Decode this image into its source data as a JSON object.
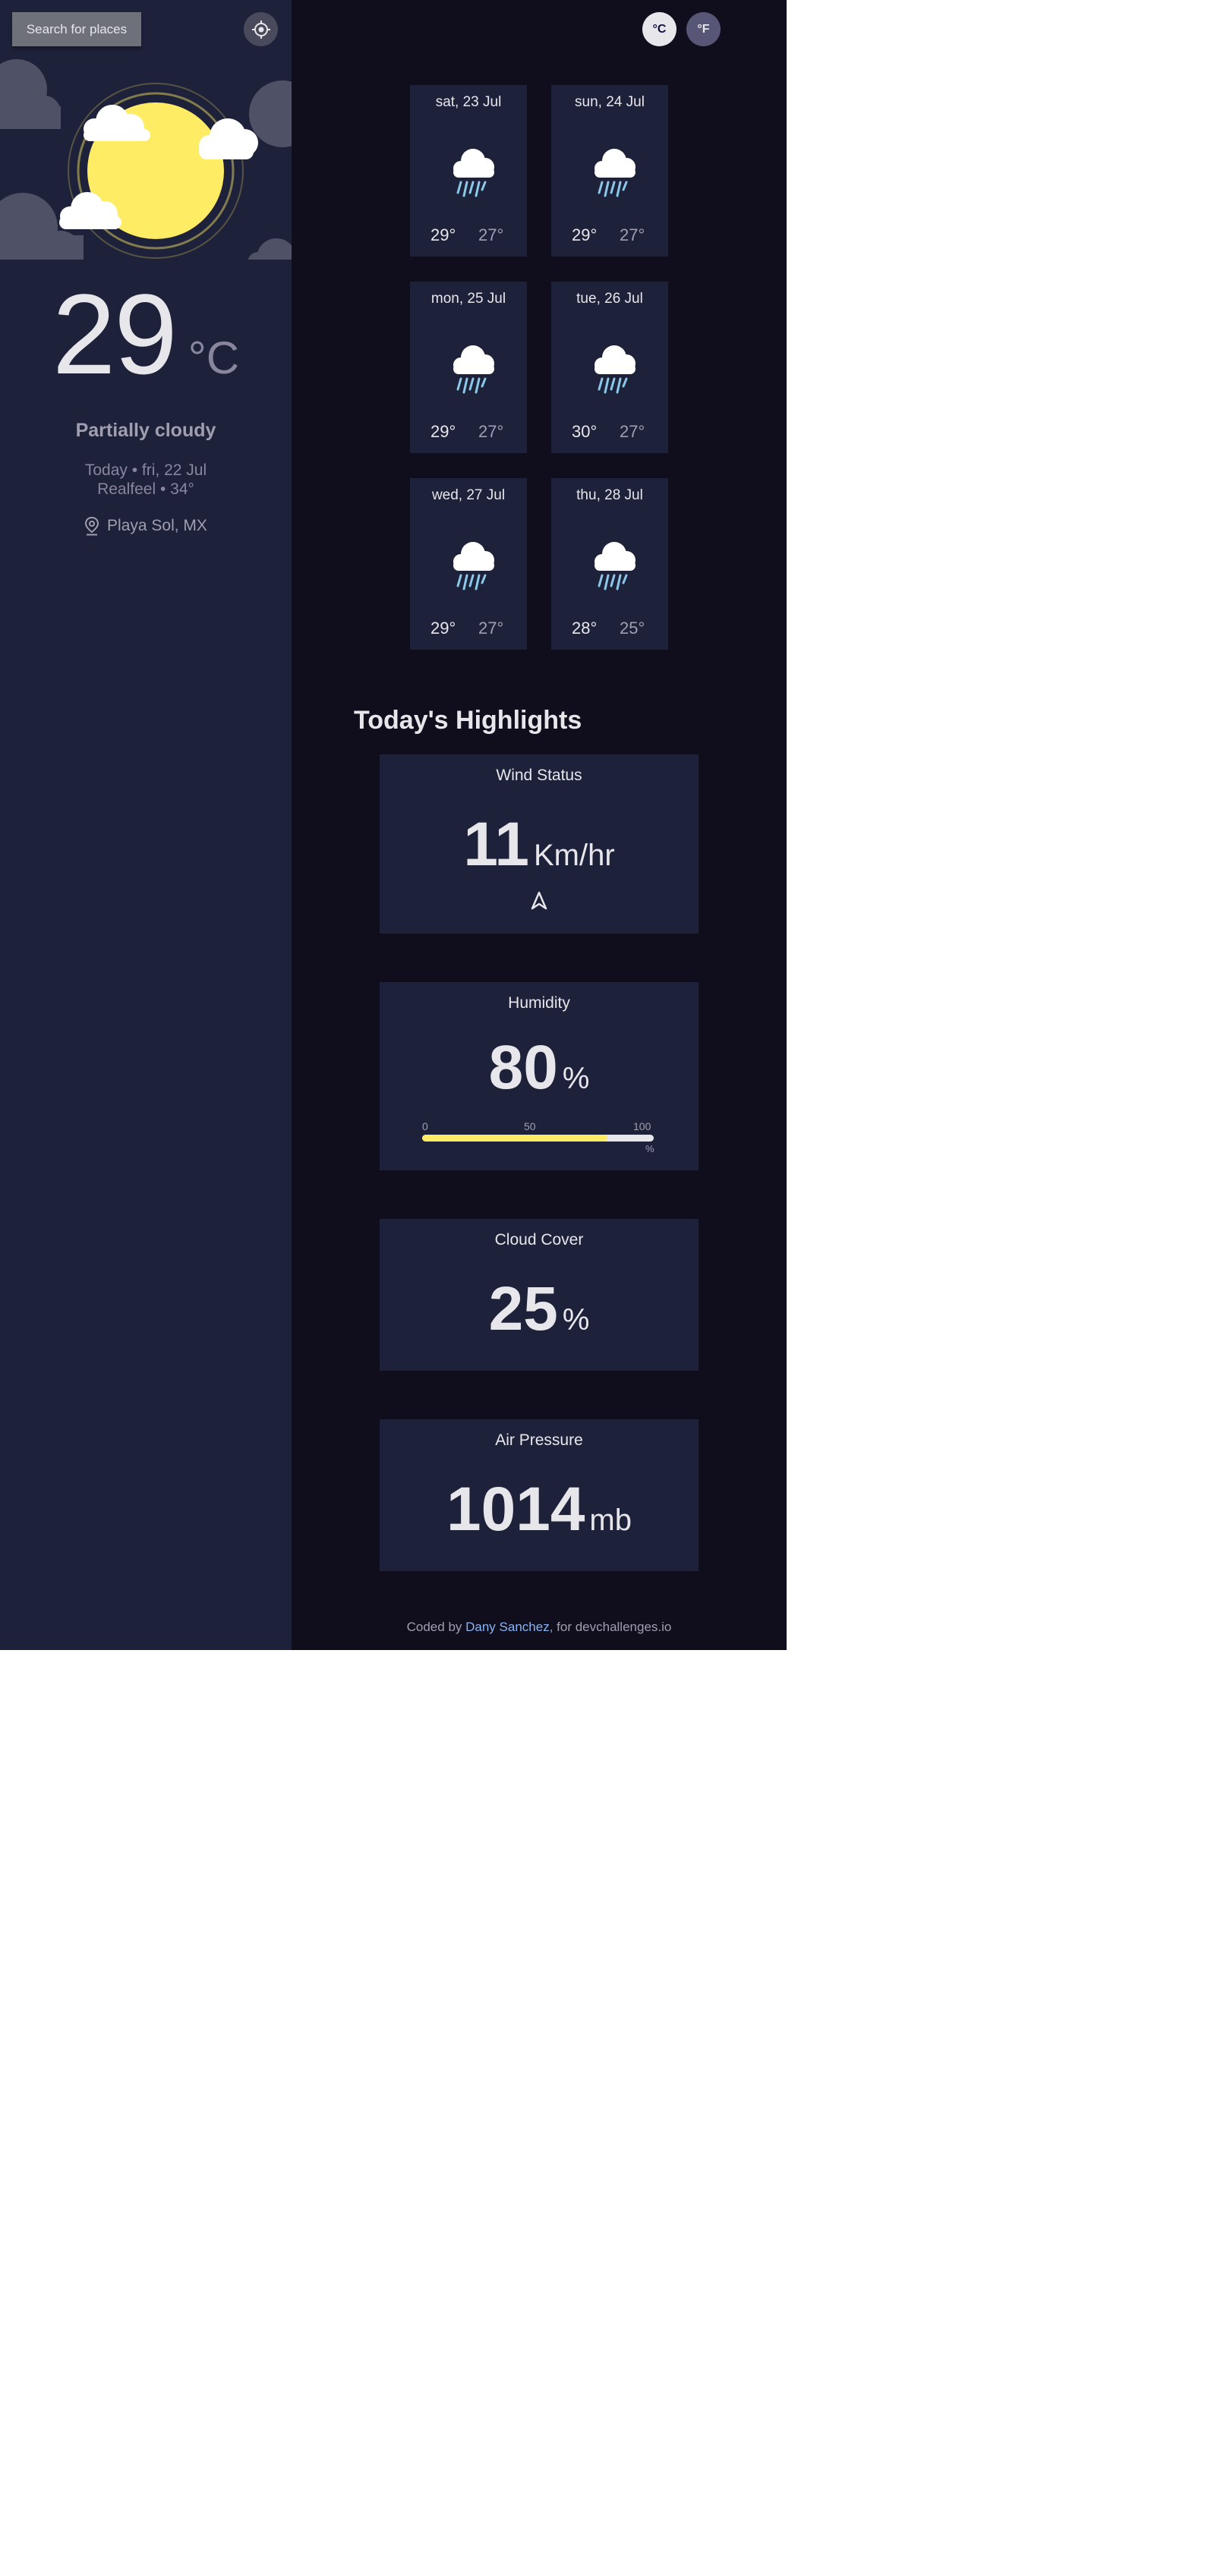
{
  "sidebar": {
    "search_label": "Search for places",
    "locate_icon": "crosshair-icon",
    "current": {
      "temperature": "29",
      "unit": "°C",
      "condition": "Partially cloudy",
      "date_line": "Today • fri, 22 Jul",
      "realfeel_line": "Realfeel • 34°",
      "location": "Playa Sol, MX"
    }
  },
  "header": {
    "celsius_label": "°C",
    "fahrenheit_label": "°F"
  },
  "forecast": [
    {
      "date": "sat, 23 Jul",
      "max": "29°",
      "min": "27°",
      "icon": "rain-cloud-icon"
    },
    {
      "date": "sun, 24 Jul",
      "max": "29°",
      "min": "27°",
      "icon": "rain-cloud-icon"
    },
    {
      "date": "mon, 25 Jul",
      "max": "29°",
      "min": "27°",
      "icon": "rain-cloud-icon"
    },
    {
      "date": "tue, 26 Jul",
      "max": "30°",
      "min": "27°",
      "icon": "rain-cloud-icon"
    },
    {
      "date": "wed, 27 Jul",
      "max": "29°",
      "min": "27°",
      "icon": "rain-cloud-icon"
    },
    {
      "date": "thu, 28 Jul",
      "max": "28°",
      "min": "25°",
      "icon": "rain-cloud-icon"
    }
  ],
  "highlights": {
    "title": "Today's Highlights",
    "wind": {
      "title": "Wind Status",
      "value": "11",
      "unit": "Km/hr",
      "icon": "navigation-arrow-icon"
    },
    "humidity": {
      "title": "Humidity",
      "value": "80",
      "unit": "%",
      "scale": {
        "min": "0",
        "mid": "50",
        "max": "100",
        "unit": "%"
      },
      "level_percent": 80
    },
    "cloud_cover": {
      "title": "Cloud Cover",
      "value": "25",
      "unit": "%"
    },
    "air_pressure": {
      "title": "Air Pressure",
      "value": "1014",
      "unit": "mb"
    }
  },
  "footer": {
    "prefix": "Coded by ",
    "author": "Dany Sanchez",
    "suffix": ", for devchallenges.io"
  },
  "colors": {
    "sidebar_bg": "#1e213a",
    "main_bg": "#100e1d",
    "card_bg": "#1e213a",
    "accent_yellow": "#ffec65",
    "link_blue": "#88b4f4"
  }
}
